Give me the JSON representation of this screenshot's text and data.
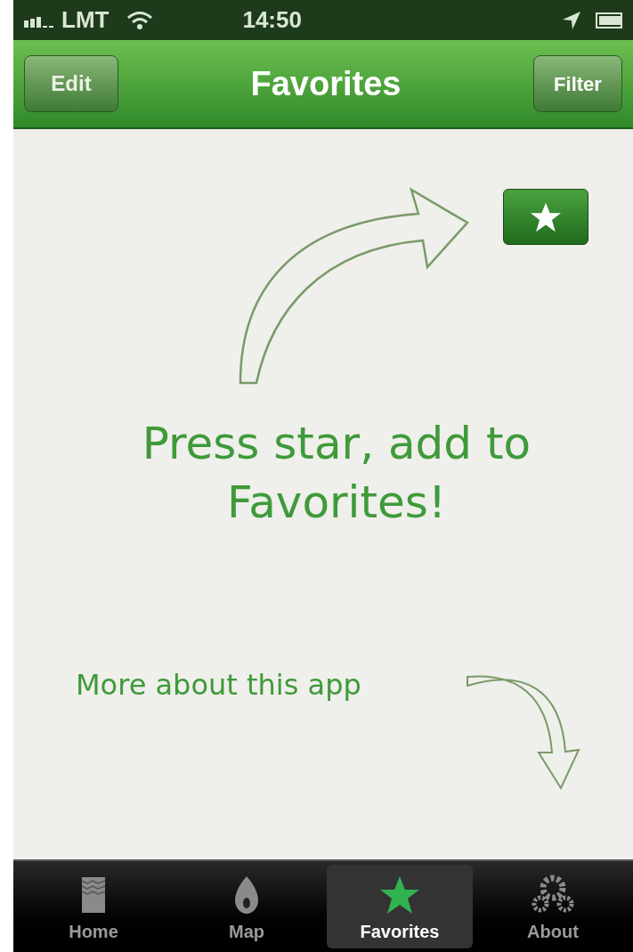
{
  "status_bar": {
    "carrier": "LMT",
    "time": "14:50"
  },
  "nav_bar": {
    "left_button": "Edit",
    "title": "Favorites",
    "right_button": "Filter"
  },
  "hint": {
    "main": "Press star, add to Favorites!",
    "secondary": "More about this app"
  },
  "tabs": [
    {
      "label": "Home",
      "kind": "home",
      "selected": false
    },
    {
      "label": "Map",
      "kind": "map",
      "selected": false
    },
    {
      "label": "Favorites",
      "kind": "favorites",
      "selected": true
    },
    {
      "label": "About",
      "kind": "about",
      "selected": false
    }
  ]
}
